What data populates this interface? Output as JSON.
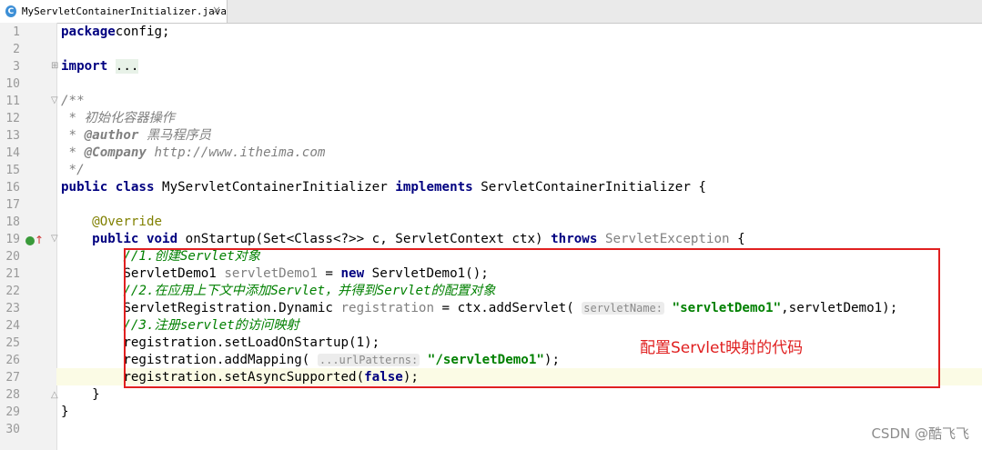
{
  "tab": {
    "icon_letter": "C",
    "filename": "MyServletContainerInitializer.java",
    "close": "×"
  },
  "lines": [
    {
      "n": "1",
      "segs": [
        [
          "kw",
          "package"
        ],
        [
          "",
          "config;"
        ]
      ]
    },
    {
      "n": "2",
      "segs": []
    },
    {
      "n": "3",
      "segs": [
        [
          "kw",
          "import"
        ],
        [
          "",
          " "
        ],
        [
          "fold-bg",
          "..."
        ]
      ]
    },
    {
      "n": "10",
      "segs": []
    },
    {
      "n": "11",
      "segs": [
        [
          "cm",
          "/**"
        ]
      ]
    },
    {
      "n": "12",
      "segs": [
        [
          "cm",
          " * 初始化容器操作"
        ]
      ]
    },
    {
      "n": "13",
      "segs": [
        [
          "cm",
          " * "
        ],
        [
          "tag",
          "@author"
        ],
        [
          "cm",
          " 黑马程序员"
        ]
      ]
    },
    {
      "n": "14",
      "segs": [
        [
          "cm",
          " * "
        ],
        [
          "tag",
          "@Company"
        ],
        [
          "cm",
          " http://www.itheima.com"
        ]
      ]
    },
    {
      "n": "15",
      "segs": [
        [
          "cm",
          " */"
        ]
      ]
    },
    {
      "n": "16",
      "segs": [
        [
          "kw",
          "public class"
        ],
        [
          "",
          " MyServletContainerInitializer "
        ],
        [
          "kw",
          "implements"
        ],
        [
          "",
          " ServletContainerInitializer {"
        ]
      ]
    },
    {
      "n": "17",
      "segs": []
    },
    {
      "n": "18",
      "segs": [
        [
          "",
          "    "
        ],
        [
          "ann",
          "@Override"
        ]
      ]
    },
    {
      "n": "19",
      "segs": [
        [
          "",
          "    "
        ],
        [
          "kw",
          "public void"
        ],
        [
          "",
          " onStartup(Set<Class<?>> c, ServletContext ctx) "
        ],
        [
          "kw",
          "throws"
        ],
        [
          "",
          " "
        ],
        [
          "gray",
          "ServletException"
        ],
        [
          "",
          " {"
        ]
      ]
    },
    {
      "n": "20",
      "segs": [
        [
          "",
          "        "
        ],
        [
          "cmg",
          "//1.创建Servlet对象"
        ]
      ]
    },
    {
      "n": "21",
      "segs": [
        [
          "",
          "        ServletDemo1 "
        ],
        [
          "gray",
          "servletDemo1"
        ],
        [
          "",
          " = "
        ],
        [
          "kw",
          "new"
        ],
        [
          "",
          " ServletDemo1();"
        ]
      ]
    },
    {
      "n": "22",
      "segs": [
        [
          "",
          "        "
        ],
        [
          "cmg",
          "//2.在应用上下文中添加Servlet，并得到Servlet的配置对象"
        ]
      ]
    },
    {
      "n": "23",
      "segs": [
        [
          "",
          "        ServletRegistration.Dynamic "
        ],
        [
          "gray",
          "registration"
        ],
        [
          "",
          " = ctx.addServlet( "
        ],
        [
          "hint",
          "servletName:"
        ],
        [
          "",
          " "
        ],
        [
          "str",
          "\"servletDemo1\""
        ],
        [
          "",
          ",servletDemo1);"
        ]
      ]
    },
    {
      "n": "24",
      "segs": [
        [
          "",
          "        "
        ],
        [
          "cmg",
          "//3.注册servlet的访问映射"
        ]
      ]
    },
    {
      "n": "25",
      "segs": [
        [
          "",
          "        registration.setLoadOnStartup(1);"
        ]
      ]
    },
    {
      "n": "26",
      "segs": [
        [
          "",
          "        registration.addMapping( "
        ],
        [
          "hint",
          "...urlPatterns:"
        ],
        [
          "",
          " "
        ],
        [
          "str",
          "\"/servletDemo1\""
        ],
        [
          "",
          ");"
        ]
      ]
    },
    {
      "n": "27",
      "segs": [
        [
          "",
          "        registration.setAsyncSupported("
        ],
        [
          "kw",
          "false"
        ],
        [
          "",
          ");"
        ]
      ]
    },
    {
      "n": "28",
      "segs": [
        [
          "",
          "    }"
        ]
      ]
    },
    {
      "n": "29",
      "segs": [
        [
          "",
          "}"
        ]
      ]
    },
    {
      "n": "30",
      "segs": []
    }
  ],
  "annotation": {
    "label": "配置Servlet映射的代码",
    "color": "#e02020"
  },
  "watermark": "CSDN @酷飞飞"
}
